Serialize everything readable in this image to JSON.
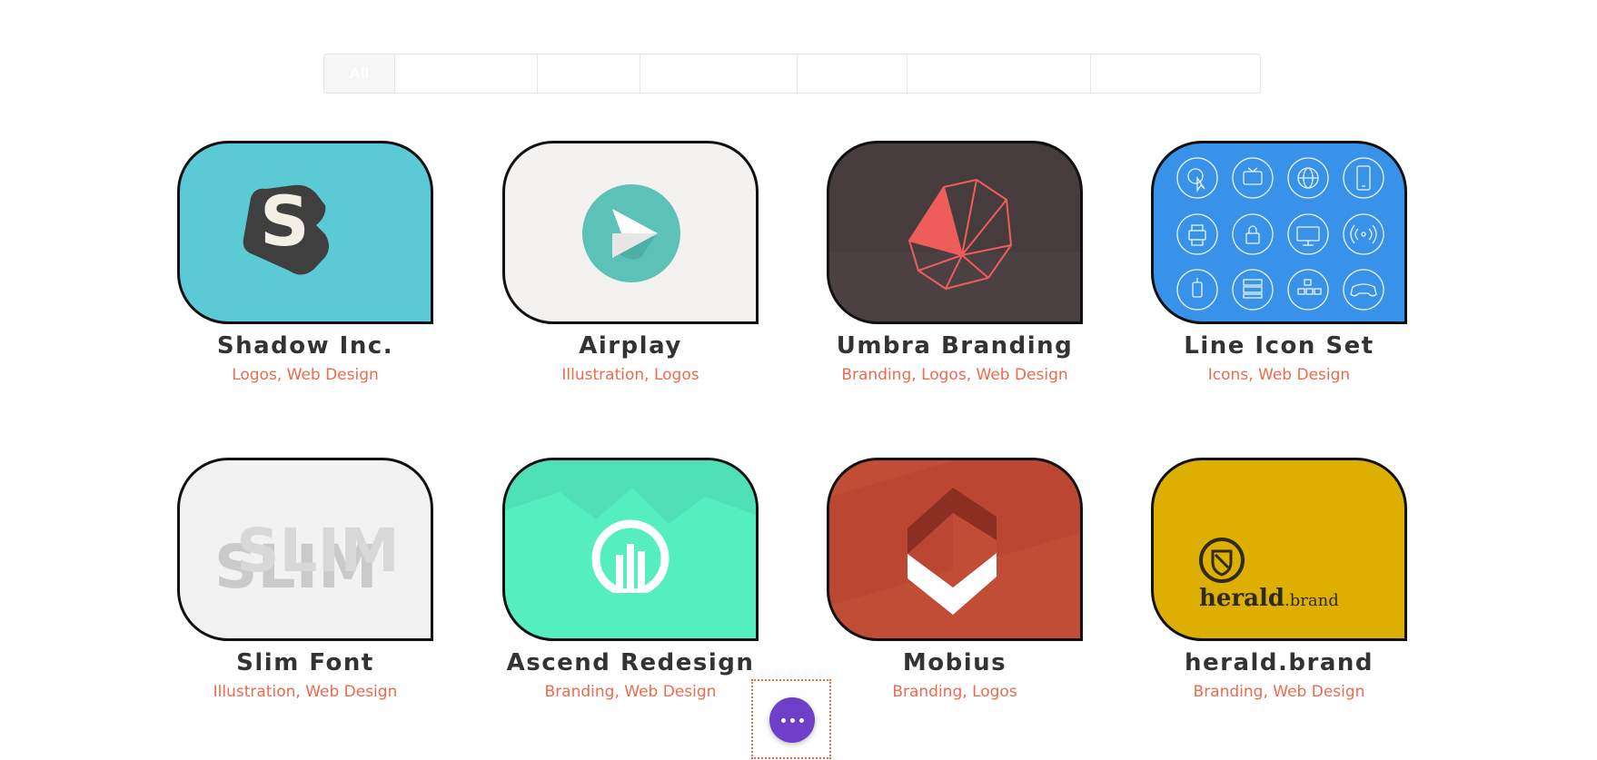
{
  "filters": [
    "All",
    "",
    "",
    "",
    "",
    "",
    ""
  ],
  "projects": [
    {
      "title": "Shadow Inc.",
      "categories": [
        "Logos",
        "Web Design"
      ],
      "bg": "#5bcad4"
    },
    {
      "title": "Airplay",
      "categories": [
        "Illustration",
        "Logos"
      ],
      "bg": "#f3f2f0"
    },
    {
      "title": "Umbra Branding",
      "categories": [
        "Branding",
        "Logos",
        "Web Design"
      ],
      "bg": "#463c3d"
    },
    {
      "title": "Line Icon Set",
      "categories": [
        "Icons",
        "Web Design"
      ],
      "bg": "#3892ea"
    },
    {
      "title": "Slim Font",
      "categories": [
        "Illustration",
        "Web Design"
      ],
      "bg": "#f2f2f2"
    },
    {
      "title": "Ascend Redesign",
      "categories": [
        "Branding",
        "Web Design"
      ],
      "bg": "#55eebf"
    },
    {
      "title": "Mobius",
      "categories": [
        "Branding",
        "Logos"
      ],
      "bg": "#c14d36"
    },
    {
      "title": "herald.brand",
      "categories": [
        "Branding",
        "Web Design"
      ],
      "bg": "#dcaf00"
    }
  ],
  "thumb_text": {
    "slim": "SLIM",
    "herald_main": "herald",
    "herald_dot": ".brand"
  },
  "colors": {
    "accent": "#ef6a4c",
    "fab": "#6f3fc9"
  }
}
